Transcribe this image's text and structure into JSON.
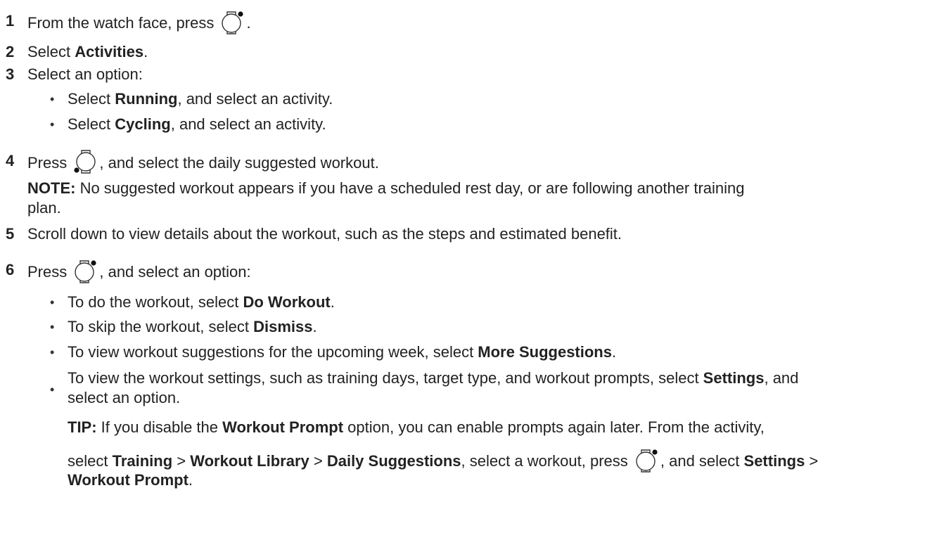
{
  "steps": [
    {
      "n": "1",
      "a": "From the watch face, press ",
      "b": "."
    },
    {
      "n": "2",
      "a": "Select ",
      "bold": "Activities",
      "b": "."
    },
    {
      "n": "3",
      "a": "Select an option:"
    },
    {
      "n": "4",
      "a": "Press ",
      "b": ", and select the daily suggested workout."
    },
    {
      "n": "5",
      "a": "Scroll down to view details about the workout, such as the steps and estimated benefit."
    },
    {
      "n": "6",
      "a": "Press ",
      "b": ", and select an option:"
    }
  ],
  "step3_bullets": [
    {
      "a": "Select ",
      "bold": "Running",
      "b": ", and select an activity."
    },
    {
      "a": "Select ",
      "bold": "Cycling",
      "b": ", and select an activity."
    }
  ],
  "step4_note": {
    "label": "NOTE:",
    "line1": " No suggested workout appears if you have a scheduled rest day, or are following another training",
    "line2": "plan."
  },
  "step6_bullets": [
    {
      "a": "To do the workout, select ",
      "bold": "Do Workout",
      "b": "."
    },
    {
      "a": "To skip the workout, select ",
      "bold": "Dismiss",
      "b": "."
    },
    {
      "a": "To view workout suggestions for the upcoming week, select ",
      "bold": "More Suggestions",
      "b": "."
    },
    {
      "a": "To view the workout settings, such as training days, target type, and workout prompts, select ",
      "bold": "Settings",
      "b": ", and",
      "line2": "select an option."
    }
  ],
  "tip": {
    "label": "TIP:",
    "l1a": " If you disable the ",
    "l1bold": "Workout Prompt",
    "l1b": " option, you can enable prompts again later. From the activity,",
    "l2a": "select ",
    "l2b1": "Training",
    "sep": " > ",
    "l2b2": "Workout Library",
    "l2b3": "Daily Suggestions",
    "l2c": ", select a workout, press ",
    "l2d": ", and select ",
    "l2b4": "Settings",
    "l2e": " >",
    "l3bold": "Workout Prompt",
    "l3b": "."
  },
  "icons": {
    "top_right": "watch-top-right-button-icon",
    "bottom_left": "watch-bottom-left-button-icon"
  }
}
